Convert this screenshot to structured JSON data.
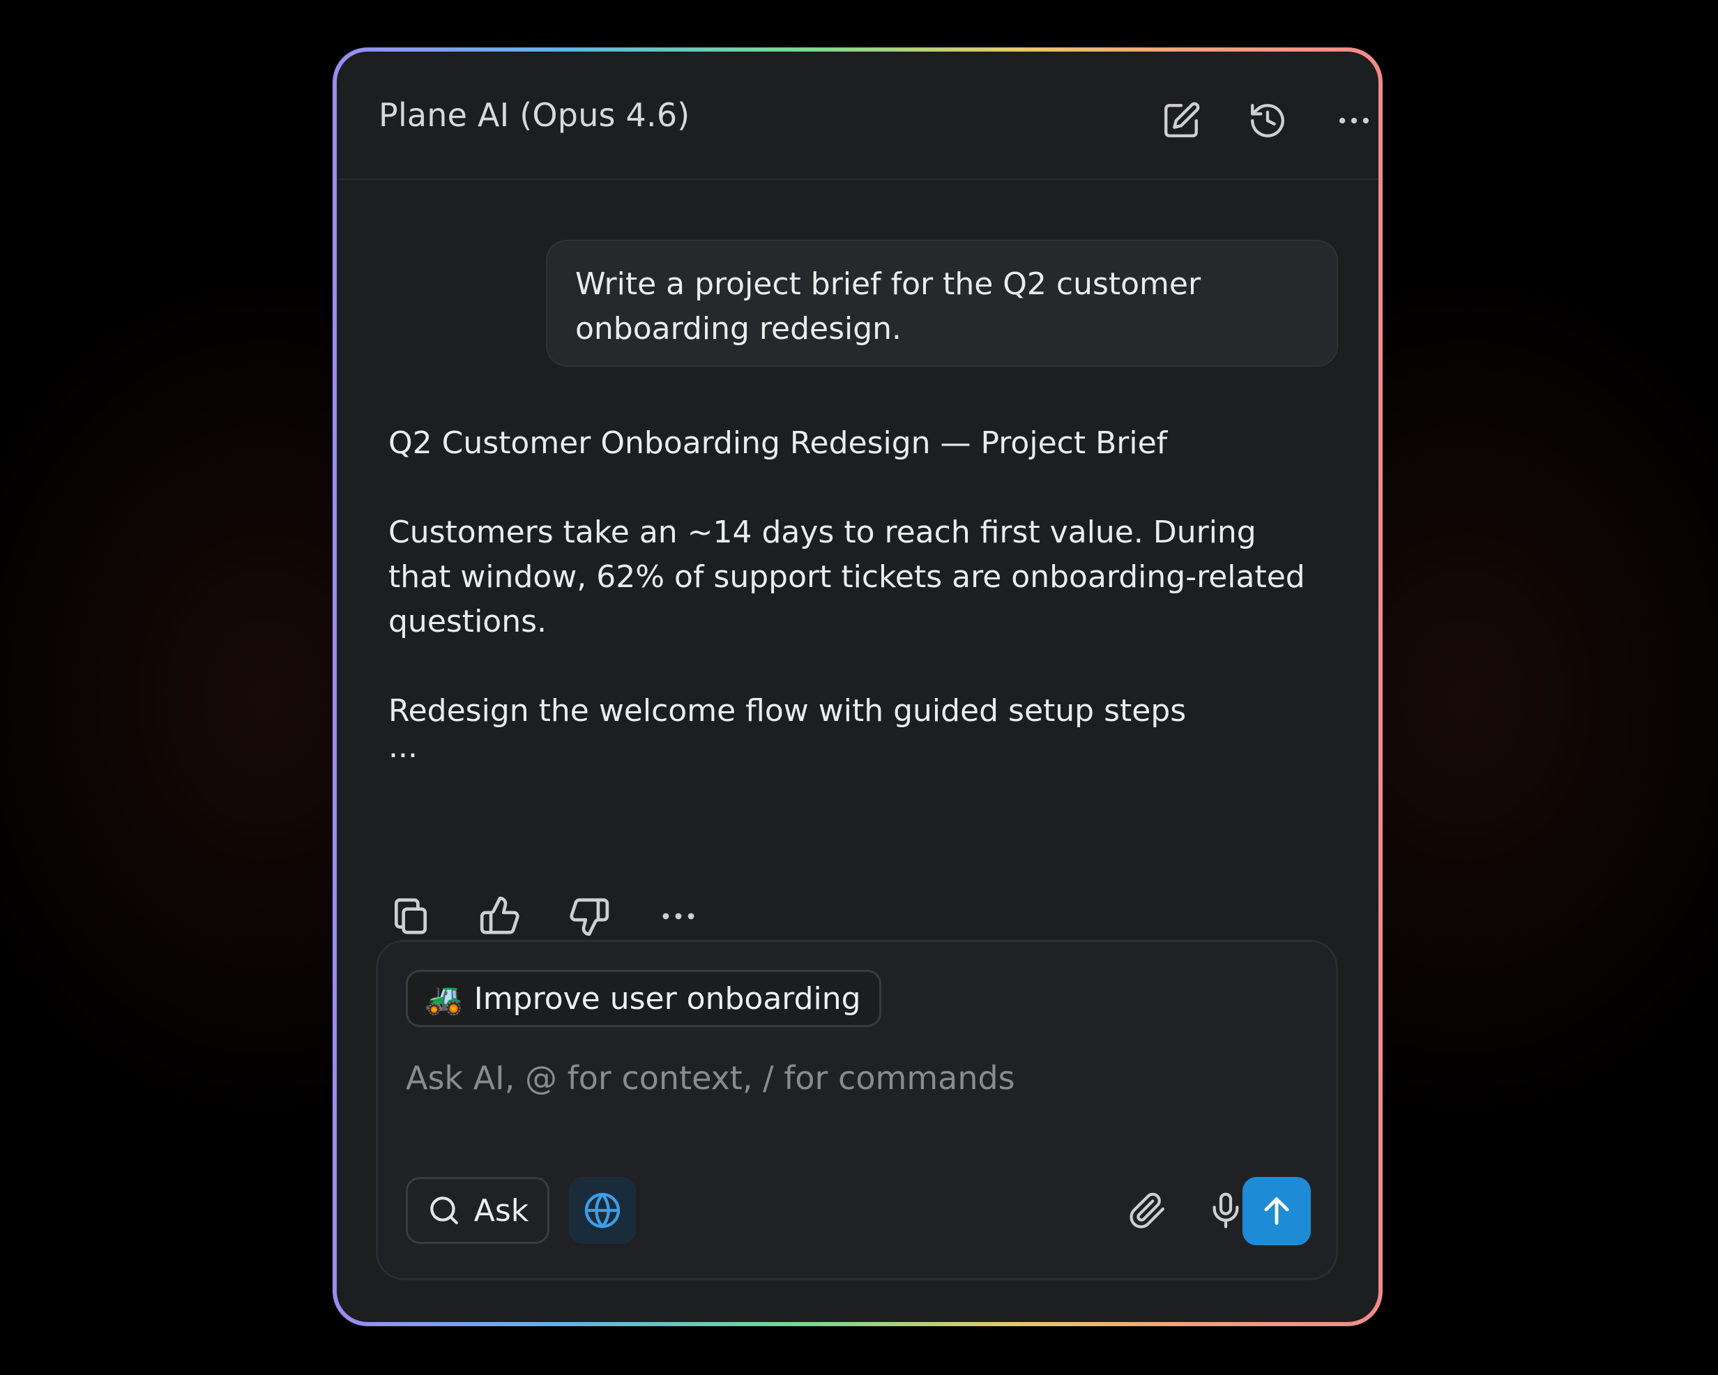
{
  "header": {
    "title": "Plane AI (Opus 4.6)",
    "icons": [
      "new-chat-icon",
      "history-icon",
      "more-icon"
    ]
  },
  "conversation": {
    "user_message": "Write a project brief for the Q2 customer onboarding redesign.",
    "assistant": {
      "heading": "Q2 Customer Onboarding Redesign — Project Brief",
      "paragraph_1": "Customers take an ~14 days to reach first value. During that window, 62% of support tickets are onboarding-related questions.",
      "paragraph_2": "Redesign the welcome flow with guided setup steps",
      "ellipsis": "..."
    },
    "actions": [
      "copy-icon",
      "thumbs-up-icon",
      "thumbs-down-icon",
      "more-icon"
    ]
  },
  "composer": {
    "context_chip": {
      "emoji": "🚜",
      "label": "Improve user onboarding"
    },
    "input_value": "",
    "placeholder": "Ask AI, @ for context, / for commands",
    "mode_button_label": "Ask",
    "icons": [
      "search-icon",
      "globe-icon",
      "paperclip-icon",
      "microphone-icon",
      "arrow-up-icon"
    ]
  },
  "colors": {
    "background": "#000000",
    "panel": "#1d1e20",
    "accent": "#1e8bd6",
    "border_gradient": [
      "#9a8cf2",
      "#5fb3e6",
      "#78d98e",
      "#e6c86a",
      "#f2a07a",
      "#f18a8a"
    ]
  }
}
